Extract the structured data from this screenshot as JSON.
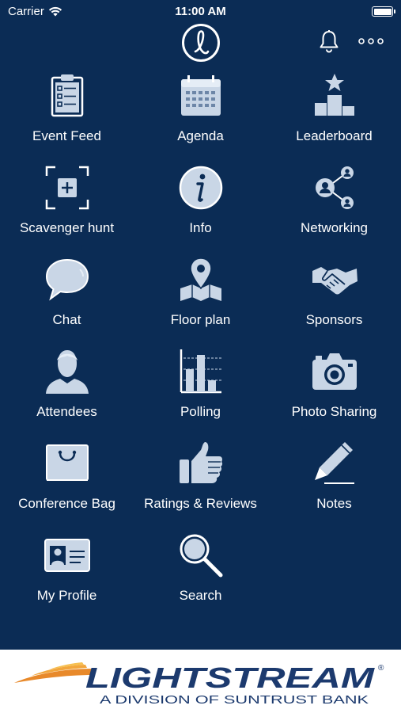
{
  "status_bar": {
    "carrier": "Carrier",
    "time": "11:00 AM"
  },
  "colors": {
    "background": "#0b2c55",
    "icon_fill": "#c9d6e6",
    "banner_text": "#1c3a6e",
    "banner_swoosh": "#e8892a"
  },
  "header": {
    "logo_icon": "app-logo-icon",
    "notifications_icon": "bell-icon",
    "menu_icon": "more-dots-icon"
  },
  "tiles": [
    {
      "label": "Event Feed",
      "icon": "clipboard-icon"
    },
    {
      "label": "Agenda",
      "icon": "calendar-icon"
    },
    {
      "label": "Leaderboard",
      "icon": "podium-icon"
    },
    {
      "label": "Scavenger hunt",
      "icon": "scan-plus-icon"
    },
    {
      "label": "Info",
      "icon": "info-icon"
    },
    {
      "label": "Networking",
      "icon": "network-icon"
    },
    {
      "label": "Chat",
      "icon": "chat-bubble-icon"
    },
    {
      "label": "Floor plan",
      "icon": "map-pin-icon"
    },
    {
      "label": "Sponsors",
      "icon": "handshake-icon"
    },
    {
      "label": "Attendees",
      "icon": "person-icon"
    },
    {
      "label": "Polling",
      "icon": "bar-chart-icon"
    },
    {
      "label": "Photo Sharing",
      "icon": "camera-icon"
    },
    {
      "label": "Conference Bag",
      "icon": "bag-icon"
    },
    {
      "label": "Ratings & Reviews",
      "icon": "thumbs-up-icon"
    },
    {
      "label": "Notes",
      "icon": "pen-icon"
    },
    {
      "label": "My Profile",
      "icon": "id-card-icon"
    },
    {
      "label": "Search",
      "icon": "magnifier-icon"
    }
  ],
  "banner": {
    "brand": "LIGHTSTREAM",
    "trademark": "®",
    "tagline": "A DIVISION OF SUNTRUST BANK"
  }
}
